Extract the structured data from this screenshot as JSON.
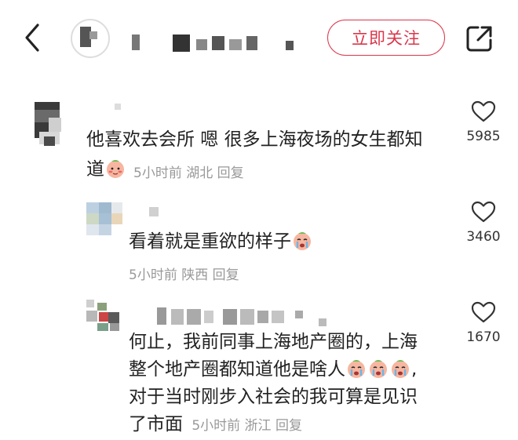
{
  "header": {
    "follow_label": "立即关注",
    "icons": {
      "back": "chevron-left-icon",
      "share": "share-icon"
    },
    "accent": "#d9374b"
  },
  "comments": [
    {
      "text": "他喜欢去会所 嗯 很多上海夜场的女生都知",
      "text_line2": "道",
      "emoji_count": 1,
      "time": "5小时前",
      "location": "湖北",
      "reply_label": "回复",
      "likes": "5985"
    },
    {
      "text": "看着就是重欲的样子",
      "emoji_count": 1,
      "time": "5小时前",
      "location": "陕西",
      "reply_label": "回复",
      "likes": "3460"
    },
    {
      "lines": [
        "何止，我前同事上海地产圈的，上海",
        "整个地产圈都知道他是啥人",
        "对于当时刚步入社会的我可算是见识",
        "了市面"
      ],
      "line2_emoji_count": 3,
      "line2_suffix": ",",
      "time": "5小时前",
      "location": "浙江",
      "reply_label": "回复",
      "likes": "1670"
    }
  ]
}
